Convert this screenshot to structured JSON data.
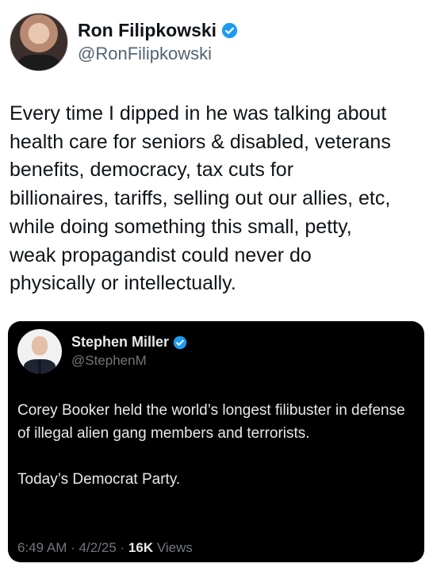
{
  "author": {
    "name": "Ron Filipkowski",
    "handle": "@RonFilipkowski",
    "verified_color": "#1d9bf0"
  },
  "tweet": {
    "text": "Every time I dipped in he was talking about\nhealth care for seniors & disabled, veterans\nbenefits, democracy, tax cuts for\nbillionaires, tariffs, selling out our allies, etc,\nwhile doing something this small, petty,\nweak propagandist could never do\nphysically or intellectually."
  },
  "quoted_tweet": {
    "name": "Stephen Miller",
    "handle": "@StephenM",
    "paragraph_1": "Corey Booker held the world’s longest filibuster in defense of illegal alien gang members and terrorists.",
    "paragraph_2": "Today’s Democrat Party.",
    "time": "6:49 AM",
    "date": "4/2/25",
    "views_count": "16K",
    "views_label": "Views",
    "separator": "·"
  }
}
